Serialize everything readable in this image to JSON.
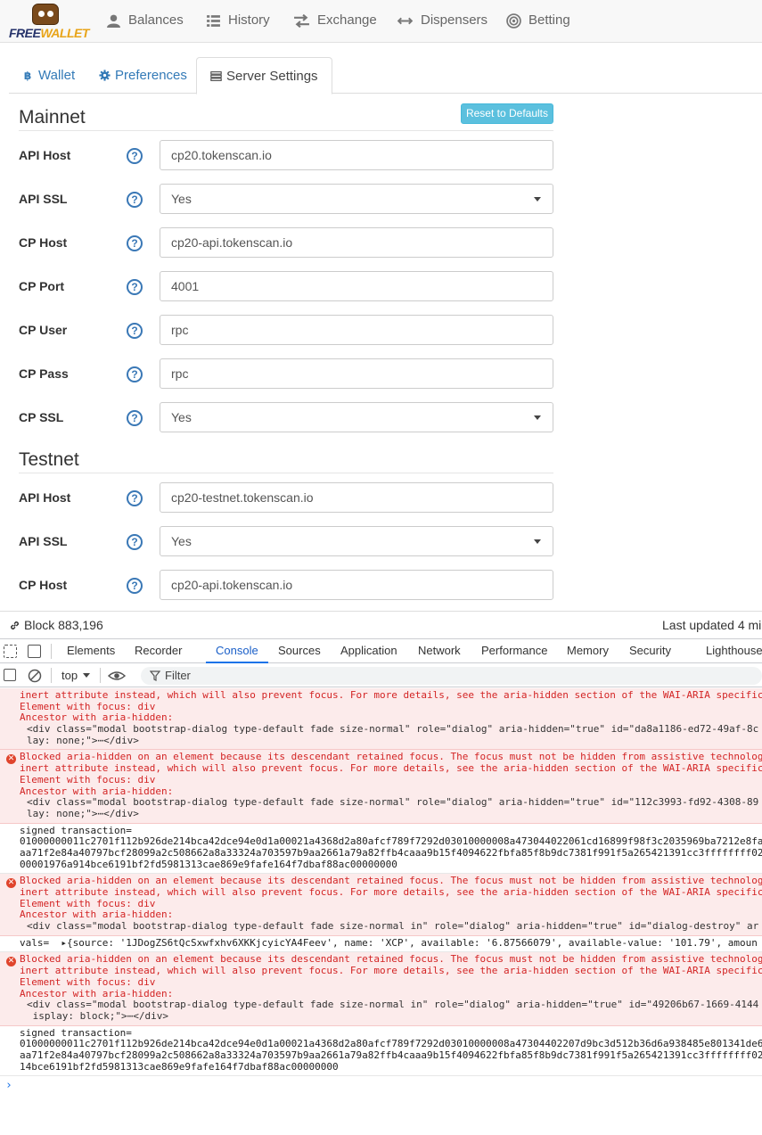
{
  "nav": {
    "logo_free": "FREE",
    "logo_wallet": "WALLET",
    "items": [
      {
        "label": "Balances",
        "icon": "user-icon"
      },
      {
        "label": "History",
        "icon": "list-icon"
      },
      {
        "label": "Exchange",
        "icon": "exchange-icon"
      },
      {
        "label": "Dispensers",
        "icon": "dispenser-icon"
      },
      {
        "label": "Betting",
        "icon": "bullseye-icon"
      }
    ]
  },
  "tabs": [
    {
      "label": "Wallet",
      "icon": "bitcoin-icon"
    },
    {
      "label": "Preferences",
      "icon": "gear-icon"
    },
    {
      "label": "Server Settings",
      "icon": "server-icon"
    }
  ],
  "mainnet": {
    "title": "Mainnet",
    "reset_label": "Reset to Defaults",
    "rows": [
      {
        "label": "API Host",
        "value": "cp20.tokenscan.io"
      },
      {
        "label": "API SSL",
        "value": "Yes"
      },
      {
        "label": "CP Host",
        "value": "cp20-api.tokenscan.io"
      },
      {
        "label": "CP Port",
        "value": "4001"
      },
      {
        "label": "CP User",
        "value": "rpc"
      },
      {
        "label": "CP Pass",
        "value": "rpc"
      },
      {
        "label": "CP SSL",
        "value": "Yes"
      }
    ]
  },
  "testnet": {
    "title": "Testnet",
    "rows": [
      {
        "label": "API Host",
        "value": "cp20-testnet.tokenscan.io"
      },
      {
        "label": "API SSL",
        "value": "Yes"
      },
      {
        "label": "CP Host",
        "value": "cp20-api.tokenscan.io"
      }
    ]
  },
  "help_glyph": "?",
  "status": {
    "block": "Block 883,196",
    "updated": "Last updated 4 mi"
  },
  "devtools": {
    "tabs": [
      "Elements",
      "Recorder",
      "Console",
      "Sources",
      "Application",
      "Network",
      "Performance",
      "Memory",
      "Security",
      "Lighthouse"
    ],
    "context": "top",
    "filter_placeholder": "Filter",
    "messages": {
      "m1": {
        "l1": "inert attribute instead, which will also prevent focus. For more details, see the aria-hidden section of the WAI-ARIA specific",
        "l2": "Element with focus: div",
        "l3": "Ancestor with aria-hidden:",
        "l4": "<div class=\"modal bootstrap-dialog type-default fade size-normal\" role=\"dialog\" aria-hidden=\"true\" id=\"da8a1186-ed72-49af-8c",
        "l5": "lay: none;\">⋯</div>"
      },
      "m2": {
        "l1": "Blocked aria-hidden on an element because its descendant retained focus. The focus must not be hidden from assistive technolog",
        "l2": "inert attribute instead, which will also prevent focus. For more details, see the aria-hidden section of the WAI-ARIA specific",
        "l3": "Element with focus: div",
        "l4": "Ancestor with aria-hidden:",
        "l5": "<div class=\"modal bootstrap-dialog type-default fade size-normal\" role=\"dialog\" aria-hidden=\"true\" id=\"112c3993-fd92-4308-89",
        "l6": "lay: none;\">⋯</div>"
      },
      "m3": {
        "l1": "signed transaction=",
        "l2": "01000000011c2701f112b926de214bca42dce94e0d1a00021a4368d2a80afcf789f7292d03010000008a473044022061cd16899f98f3c2035969ba7212e8fa",
        "l3": "aa71f2e84a40797bcf28099a2c508662a8a33324a703597b9aa2661a79a82ffb4caaa9b15f4094622fbfa85f8b9dc7381f991f5a265421391cc3ffffffff02",
        "l4": "00001976a914bce6191bf2fd5981313cae869e9fafe164f7dbaf88ac00000000"
      },
      "m4": {
        "l1": "Blocked aria-hidden on an element because its descendant retained focus. The focus must not be hidden from assistive technolog",
        "l2": "inert attribute instead, which will also prevent focus. For more details, see the aria-hidden section of the WAI-ARIA specific",
        "l3": "Element with focus: div",
        "l4": "Ancestor with aria-hidden:",
        "l5": "<div class=\"modal bootstrap-dialog type-default fade size-normal in\" role=\"dialog\" aria-hidden=\"true\" id=\"dialog-destroy\" ar"
      },
      "m5": {
        "l1": "vals=  ▸{source: '1JDogZS6tQcSxwfxhv6XKKjcyicYA4Feev', name: 'XCP', available: '6.87566079', available-value: '101.79', amoun"
      },
      "m6": {
        "l1": "Blocked aria-hidden on an element because its descendant retained focus. The focus must not be hidden from assistive technolog",
        "l2": "inert attribute instead, which will also prevent focus. For more details, see the aria-hidden section of the WAI-ARIA specific",
        "l3": "Element with focus: div",
        "l4": "Ancestor with aria-hidden:",
        "l5": "<div class=\"modal bootstrap-dialog type-default fade size-normal in\" role=\"dialog\" aria-hidden=\"true\" id=\"49206b67-1669-4144",
        "l6": " isplay: block;\">⋯</div>"
      },
      "m7": {
        "l1": "signed transaction=",
        "l2": "01000000011c2701f112b926de214bca42dce94e0d1a00021a4368d2a80afcf789f7292d03010000008a47304402207d9bc3d512b36d6a938485e801341de6",
        "l3": "aa71f2e84a40797bcf28099a2c508662a8a33324a703597b9aa2661a79a82ffb4caaa9b15f4094622fbfa85f8b9dc7381f991f5a265421391cc3ffffffff02",
        "l4": "14bce6191bf2fd5981313cae869e9fafe164f7dbaf88ac00000000"
      }
    },
    "error_glyph": "✕",
    "prompt": "›"
  }
}
